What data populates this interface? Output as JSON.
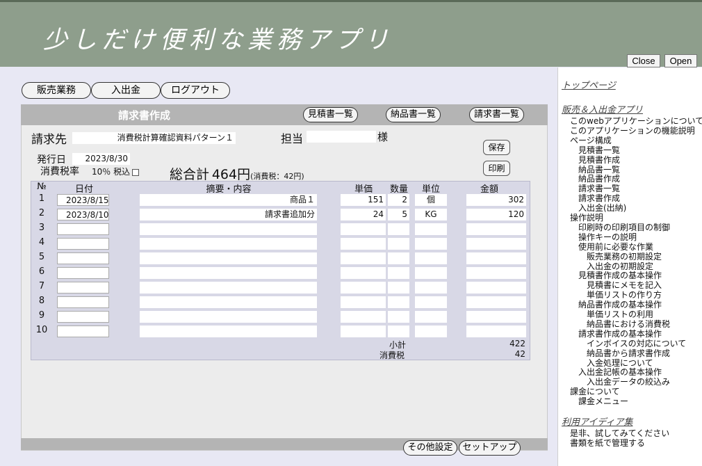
{
  "app": {
    "title": "少しだけ便利な業務アプリ"
  },
  "header_buttons": {
    "close": "Close",
    "open": "Open"
  },
  "nav": {
    "sales": "販売業務",
    "payments": "入出金",
    "logout": "ログアウト"
  },
  "panel": {
    "title": "請求書作成",
    "estimate_list": "見積書一覧",
    "delivery_list": "納品書一覧",
    "invoice_list": "請求書一覧",
    "save": "保存",
    "print": "印刷",
    "other_settings": "その他設定",
    "setup": "セットアップ"
  },
  "invoice": {
    "recipient_label": "請求先",
    "recipient_value": "消費税計算確認資料パターン１",
    "staff_label": "担当",
    "staff_value": "",
    "honorific": "様",
    "issue_date_label": "発行日",
    "issue_date_value": "2023/8/30",
    "tax_rate_label": "消費税率",
    "tax_rate_value": "10％ 税込",
    "total_label": "総合計",
    "total_value": "464円",
    "total_tax_note": "(消費税：42円)"
  },
  "table": {
    "headers": {
      "no": "№",
      "date": "日付",
      "desc": "摘要・内容",
      "unit_price": "単価",
      "qty": "数量",
      "unit": "単位",
      "amount": "金額"
    },
    "rows": [
      {
        "no": "1",
        "date": "2023/8/15",
        "desc": "商品１",
        "unit_price": "151",
        "qty": "2",
        "unit": "個",
        "amount": "302"
      },
      {
        "no": "2",
        "date": "2023/8/10",
        "desc": "請求書追加分",
        "unit_price": "24",
        "qty": "5",
        "unit": "KG",
        "amount": "120"
      },
      {
        "no": "3",
        "date": "",
        "desc": "",
        "unit_price": "",
        "qty": "",
        "unit": "",
        "amount": ""
      },
      {
        "no": "4",
        "date": "",
        "desc": "",
        "unit_price": "",
        "qty": "",
        "unit": "",
        "amount": ""
      },
      {
        "no": "5",
        "date": "",
        "desc": "",
        "unit_price": "",
        "qty": "",
        "unit": "",
        "amount": ""
      },
      {
        "no": "6",
        "date": "",
        "desc": "",
        "unit_price": "",
        "qty": "",
        "unit": "",
        "amount": ""
      },
      {
        "no": "7",
        "date": "",
        "desc": "",
        "unit_price": "",
        "qty": "",
        "unit": "",
        "amount": ""
      },
      {
        "no": "8",
        "date": "",
        "desc": "",
        "unit_price": "",
        "qty": "",
        "unit": "",
        "amount": ""
      },
      {
        "no": "9",
        "date": "",
        "desc": "",
        "unit_price": "",
        "qty": "",
        "unit": "",
        "amount": ""
      },
      {
        "no": "10",
        "date": "",
        "desc": "",
        "unit_price": "",
        "qty": "",
        "unit": "",
        "amount": ""
      }
    ],
    "subtotal_label": "小計",
    "subtotal_value": "422",
    "tax_label": "消費税",
    "tax_value": "42"
  },
  "sidebar": {
    "top_link": "トップページ",
    "section1_title": "販売＆入出金アプリ",
    "section1_items": [
      {
        "text": "このwebアプリケーションについて",
        "indent": 0
      },
      {
        "text": "このアプリケーションの機能説明",
        "indent": 0
      },
      {
        "text": "ページ構成",
        "indent": 0
      },
      {
        "text": "見積書一覧",
        "indent": 1
      },
      {
        "text": "見積書作成",
        "indent": 1
      },
      {
        "text": "納品書一覧",
        "indent": 1
      },
      {
        "text": "納品書作成",
        "indent": 1
      },
      {
        "text": "請求書一覧",
        "indent": 1
      },
      {
        "text": "請求書作成",
        "indent": 1
      },
      {
        "text": "入出金(出納)",
        "indent": 1
      },
      {
        "text": "操作説明",
        "indent": 0
      },
      {
        "text": "印刷時の印刷項目の制御",
        "indent": 1
      },
      {
        "text": "操作キーの説明",
        "indent": 1
      },
      {
        "text": "使用前に必要な作業",
        "indent": 1
      },
      {
        "text": "販売業務の初期設定",
        "indent": 2
      },
      {
        "text": "入出金の初期設定",
        "indent": 2
      },
      {
        "text": "見積書作成の基本操作",
        "indent": 1
      },
      {
        "text": "見積書にメモを記入",
        "indent": 2
      },
      {
        "text": "単価リストの作り方",
        "indent": 2
      },
      {
        "text": "納品書作成の基本操作",
        "indent": 1
      },
      {
        "text": "単価リストの利用",
        "indent": 2
      },
      {
        "text": "納品書における消費税",
        "indent": 2
      },
      {
        "text": "請求書作成の基本操作",
        "indent": 1
      },
      {
        "text": "インボイスの対応について",
        "indent": 2
      },
      {
        "text": "納品書から請求書作成",
        "indent": 2
      },
      {
        "text": "入金処理について",
        "indent": 2
      },
      {
        "text": "入出金記帳の基本操作",
        "indent": 1
      },
      {
        "text": "入出金データの絞込み",
        "indent": 2
      },
      {
        "text": "課金について",
        "indent": 0
      },
      {
        "text": "課金メニュー",
        "indent": 1
      }
    ],
    "section2_title": "利用アイディア集",
    "section2_items": [
      {
        "text": "是非、試してみてください",
        "indent": 0
      },
      {
        "text": "書類を紙で管理する",
        "indent": 0
      }
    ]
  }
}
